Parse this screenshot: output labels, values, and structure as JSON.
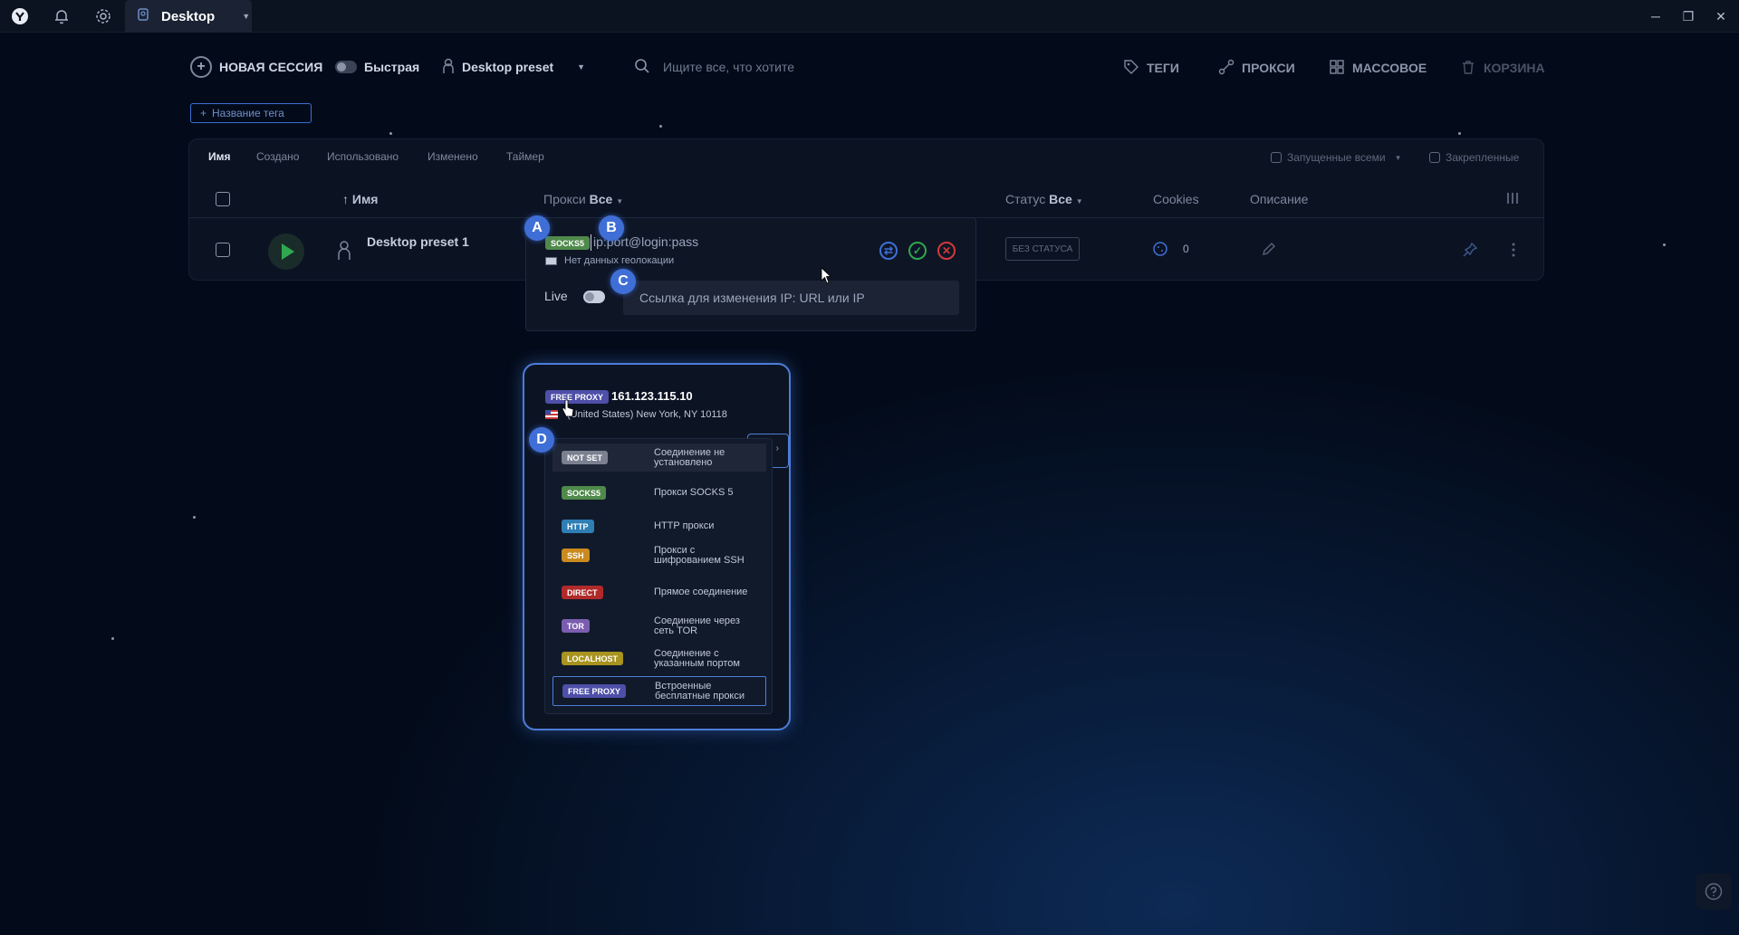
{
  "titlebar": {
    "tab_title": "Desktop"
  },
  "toolbar": {
    "new_session": "НОВАЯ СЕССИЯ",
    "quick": "Быстрая",
    "preset": "Desktop preset",
    "search_placeholder": "Ищите все, что хотите",
    "tags": "ТЕГИ",
    "proxies": "ПРОКСИ",
    "bulk": "МАССОВОЕ",
    "trash": "КОРЗИНА"
  },
  "tag_button": "Название тега",
  "sort_tabs": [
    "Имя",
    "Создано",
    "Использовано",
    "Изменено",
    "Таймер"
  ],
  "filters": {
    "running": "Запущенные всеми",
    "pinned": "Закрепленные"
  },
  "columns": {
    "name": "Имя",
    "proxy": "Прокси",
    "proxy_filter": "Все",
    "status": "Статус",
    "status_filter": "Все",
    "cookies": "Cookies",
    "description": "Описание"
  },
  "row": {
    "name": "Desktop preset 1",
    "status_badge": "БЕЗ СТАТУСА",
    "cookies_count": "0"
  },
  "proxy_editor": {
    "type_badge": "SOCKS5",
    "input_value": "ip:port@login:pass",
    "geo": "Нет данных геолокации",
    "live_label": "Live",
    "live_placeholder": "Ссылка для изменения IP: URL или IP"
  },
  "markers": [
    "A",
    "B",
    "C",
    "D"
  ],
  "free_proxy": {
    "badge": "FREE PROXY",
    "ip": "161.123.115.10",
    "location": "(United States) New York, NY 10118"
  },
  "proxy_types": [
    {
      "badge": "NOT SET",
      "desc": "Соединение не установлено",
      "color": "#7b8190"
    },
    {
      "badge": "SOCKS5",
      "desc": "Прокси SOCKS 5",
      "color": "#4f8a4a"
    },
    {
      "badge": "HTTP",
      "desc": "HTTP прокси",
      "color": "#2f7fb5"
    },
    {
      "badge": "SSH",
      "desc": "Прокси с шифрованием SSH",
      "color": "#c98a1e"
    },
    {
      "badge": "DIRECT",
      "desc": "Прямое соединение",
      "color": "#b02a2a"
    },
    {
      "badge": "TOR",
      "desc": "Соединение через сеть TOR",
      "color": "#7b5db0"
    },
    {
      "badge": "LOCALHOST",
      "desc": "Соединение с указанным портом",
      "color": "#a8941e"
    },
    {
      "badge": "FREE PROXY",
      "desc": "Встроенные бесплатные прокси",
      "color": "#4d4fa8"
    }
  ]
}
